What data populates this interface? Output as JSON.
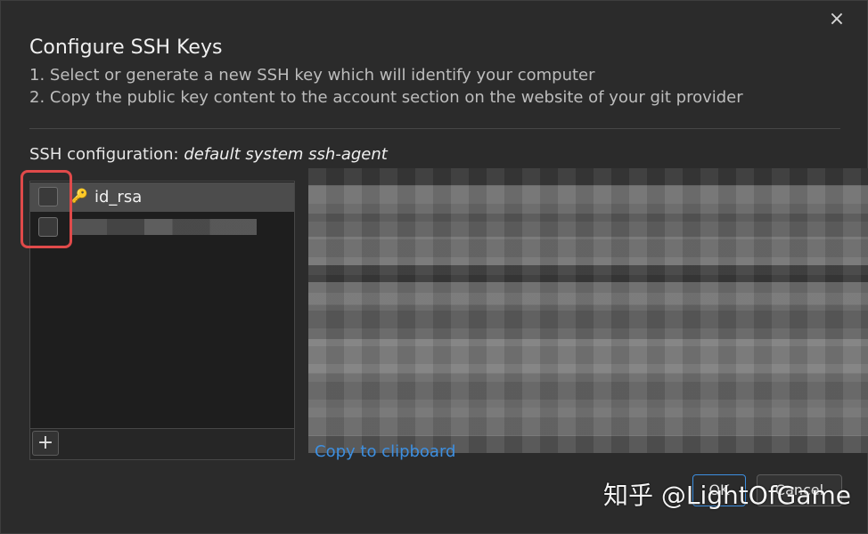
{
  "dialog": {
    "title": "Configure SSH Keys",
    "step1": "1. Select or generate a new SSH key which will identify your computer",
    "step2": "2. Copy the public key content to the account section on the website of your git provider",
    "config_label": "SSH configuration:",
    "config_value": "default system ssh-agent",
    "close_icon": "×"
  },
  "keys": {
    "items": [
      {
        "label": "id_rsa",
        "checked": false,
        "selected": true
      },
      {
        "label": "",
        "checked": false,
        "selected": false
      }
    ],
    "add_label": "+"
  },
  "public_key": {
    "copy_link": "Copy to clipboard"
  },
  "buttons": {
    "ok": "OK",
    "cancel": "Cancel"
  },
  "watermark": "知乎 @LightOfGame",
  "colors": {
    "accent": "#3d8fe0",
    "highlight": "#e04a4a",
    "background": "#2b2b2b"
  }
}
